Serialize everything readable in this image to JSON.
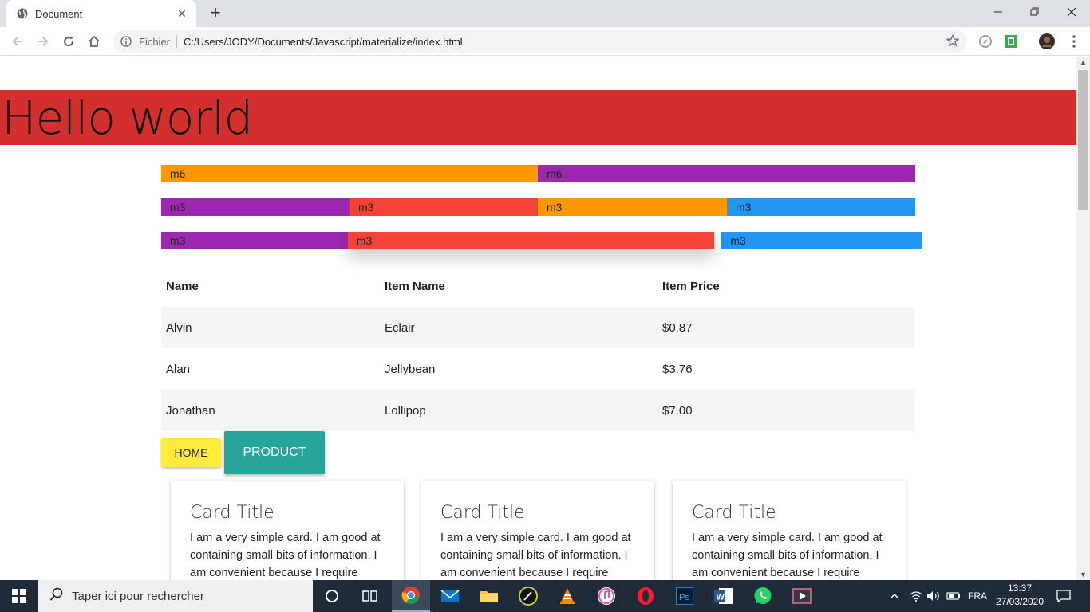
{
  "browser": {
    "tab_title": "Document",
    "new_tab": "+",
    "url_label": "Fichier",
    "url": "C:/Users/JODY/Documents/Javascript/materialize/index.html"
  },
  "page": {
    "heading": "Hello world",
    "grid_rows": [
      [
        {
          "label": "m6",
          "color": "#ff9800"
        },
        {
          "label": "m6",
          "color": "#9c27b0"
        }
      ],
      [
        {
          "label": "m3",
          "color": "#9c27b0"
        },
        {
          "label": "m3",
          "color": "#f44336"
        },
        {
          "label": "m3",
          "color": "#ff9800"
        },
        {
          "label": "m3",
          "color": "#2196f3"
        }
      ],
      [
        {
          "label": "m3",
          "color": "#9c27b0"
        },
        {
          "label": "m3",
          "color": "#f44336"
        },
        {
          "label": "m3",
          "color": "#2196f3"
        }
      ]
    ],
    "table": {
      "headers": [
        "Name",
        "Item Name",
        "Item Price"
      ],
      "rows": [
        [
          "Alvin",
          "Eclair",
          "$0.87"
        ],
        [
          "Alan",
          "Jellybean",
          "$3.76"
        ],
        [
          "Jonathan",
          "Lollipop",
          "$7.00"
        ]
      ]
    },
    "buttons": {
      "home": "HOME",
      "product": "PRODUCT"
    },
    "cards": [
      {
        "title": "Card Title",
        "text": "I am a very simple card. I am good at containing small bits of information. I am convenient because I require"
      },
      {
        "title": "Card Title",
        "text": "I am a very simple card. I am good at containing small bits of information. I am convenient because I require"
      },
      {
        "title": "Card Title",
        "text": "I am a very simple card. I am good at containing small bits of information. I am convenient because I require"
      }
    ]
  },
  "taskbar": {
    "search_placeholder": "Taper ici pour rechercher",
    "language": "FRA",
    "time": "13:37",
    "date": "27/03/2020",
    "apps": [
      "task-view",
      "chrome",
      "mail",
      "file-explorer",
      "inkscape",
      "vlc",
      "itunes",
      "opera",
      "photoshop",
      "word",
      "whatsapp",
      "video-player"
    ]
  },
  "colors": {
    "hero": "#d32f2f",
    "home_button": "#ffeb3b",
    "product_button": "#26a69a"
  }
}
